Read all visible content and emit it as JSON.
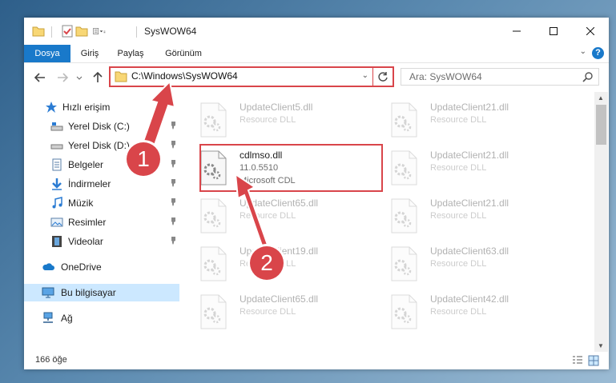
{
  "window": {
    "title": "SysWOW64",
    "controls": {
      "minimize": "minimize-icon",
      "maximize": "maximize-icon",
      "close": "close-icon"
    }
  },
  "ribbon": {
    "tabs": [
      {
        "label": "Dosya"
      },
      {
        "label": "Giriş"
      },
      {
        "label": "Paylaş"
      },
      {
        "label": "Görünüm"
      }
    ],
    "help_label": "?"
  },
  "address": {
    "path": "C:\\Windows\\SysWOW64",
    "search_placeholder": "Ara: SysWOW64"
  },
  "nav": {
    "items": [
      {
        "label": "Hızlı erişim",
        "icon": "star-icon"
      },
      {
        "label": "Yerel Disk (C:)",
        "icon": "drive-icon",
        "pinned": true
      },
      {
        "label": "Yerel Disk (D:)",
        "icon": "drive-icon",
        "pinned": true
      },
      {
        "label": "Belgeler",
        "icon": "documents-icon",
        "pinned": true
      },
      {
        "label": "İndirmeler",
        "icon": "download-icon",
        "pinned": true
      },
      {
        "label": "Müzik",
        "icon": "music-icon",
        "pinned": true
      },
      {
        "label": "Resimler",
        "icon": "pictures-icon",
        "pinned": true
      },
      {
        "label": "Videolar",
        "icon": "videos-icon",
        "pinned": true
      },
      {
        "label": "OneDrive",
        "icon": "cloud-icon"
      },
      {
        "label": "Bu bilgisayar",
        "icon": "computer-icon",
        "selected": true
      },
      {
        "label": "Ağ",
        "icon": "network-icon"
      }
    ]
  },
  "files": {
    "left": [
      {
        "name": "UpdateClient5.dll",
        "desc": "Resource DLL",
        "faded": true
      },
      {
        "name": "cdlmso.dll",
        "version": "11.0.5510",
        "desc": "Microsoft CDL",
        "faded": false
      },
      {
        "name": "UpdateClient65.dll",
        "desc": "Resource DLL",
        "faded": true
      },
      {
        "name": "UpdateClient19.dll",
        "desc": "Resource DLL",
        "faded": true
      },
      {
        "name": "UpdateClient65.dll",
        "desc": "Resource DLL",
        "faded": true
      }
    ],
    "right": [
      {
        "name": "UpdateClient21.dll",
        "desc": "Resource DLL",
        "faded": true
      },
      {
        "name": "UpdateClient21.dll",
        "desc": "Resource DLL",
        "faded": true
      },
      {
        "name": "UpdateClient21.dll",
        "desc": "Resource DLL",
        "faded": true
      },
      {
        "name": "UpdateClient63.dll",
        "desc": "Resource DLL",
        "faded": true
      },
      {
        "name": "UpdateClient42.dll",
        "desc": "Resource DLL",
        "faded": true
      }
    ]
  },
  "status": {
    "item_count": "166 öğe"
  },
  "callouts": [
    "1",
    "2"
  ],
  "colors": {
    "accent": "#1979ca",
    "highlight": "#d9454a",
    "selected": "#cce8ff"
  }
}
